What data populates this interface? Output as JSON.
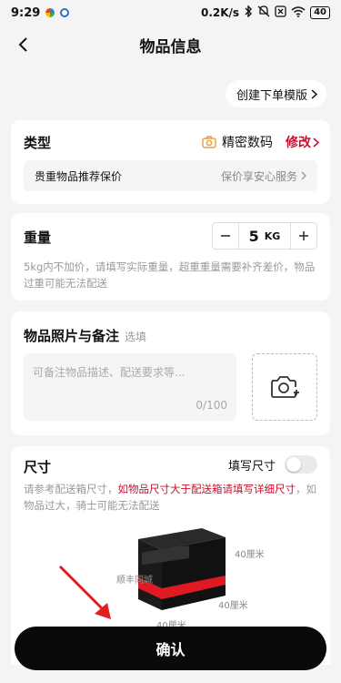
{
  "status": {
    "time": "9:29",
    "net_speed": "0.2K/s",
    "battery": "40"
  },
  "header": {
    "title": "物品信息"
  },
  "template_button": {
    "label": "创建下单模版"
  },
  "type_section": {
    "title": "类型",
    "selected_type": "精密数码",
    "edit_label": "修改",
    "insure_label": "贵重物品推荐保价",
    "insure_action": "保价享安心服务"
  },
  "weight_section": {
    "title": "重量",
    "value": "5",
    "unit": "KG",
    "note": "5kg内不加价，请填写实际重量，超重重量需要补齐差价，物品过重可能无法配送"
  },
  "photo_section": {
    "title": "物品照片与备注",
    "optional": "选填",
    "placeholder": "可备注物品描述、配送要求等...",
    "counter": "0/100"
  },
  "size_section": {
    "title": "尺寸",
    "toggle_label": "填写尺寸",
    "note_prefix": "请参考配送箱尺寸，",
    "note_highlight": "如物品尺寸大于配送箱请填写详细尺寸",
    "note_suffix": "，如物品过大，骑士可能无法配送",
    "box_brand": "顺丰同城",
    "height_label": "40厘米",
    "depth_label": "40厘米",
    "width_label": "40厘米"
  },
  "confirm_button": {
    "label": "确认"
  },
  "colors": {
    "accent": "#c8102e",
    "button": "#0a0a0a"
  }
}
